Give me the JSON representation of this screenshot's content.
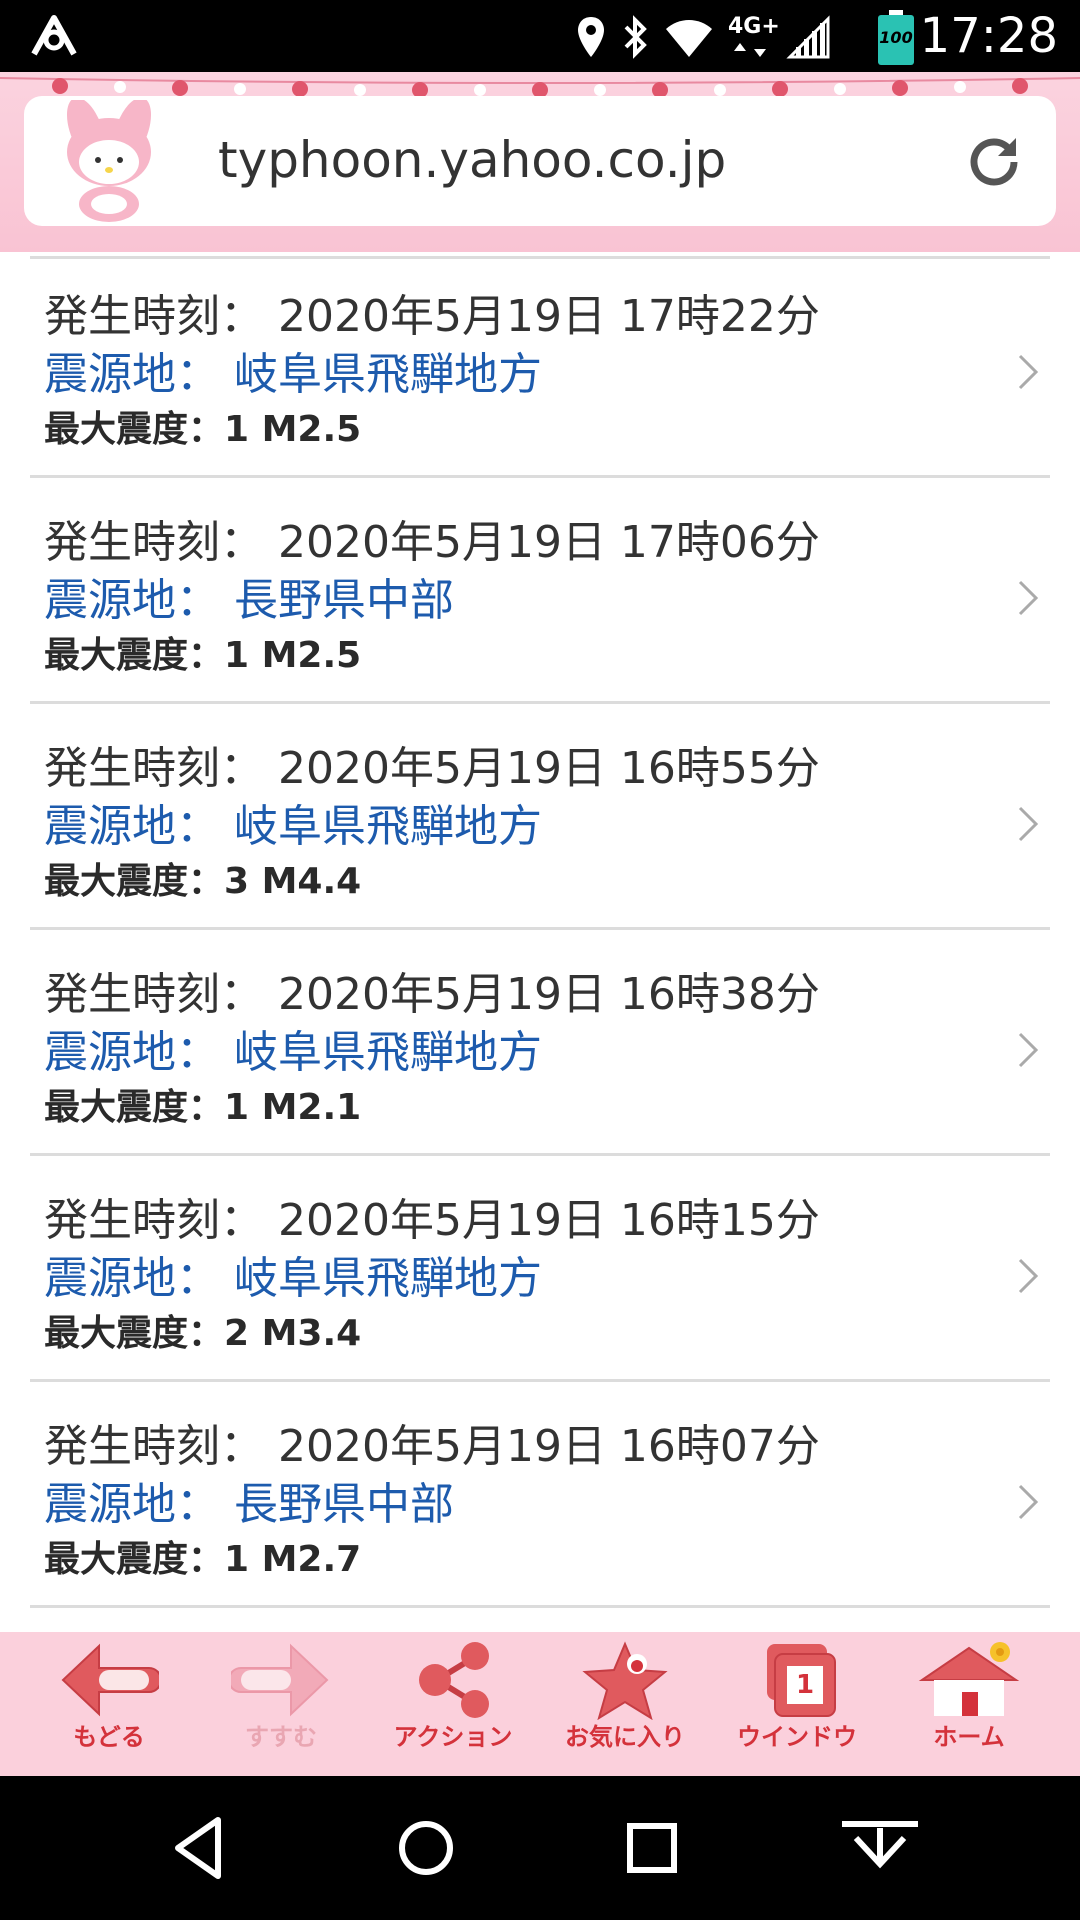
{
  "status_bar": {
    "network": "4G+",
    "battery": "100",
    "time": "17:28"
  },
  "browser": {
    "url": "typhoon.yahoo.co.jp"
  },
  "earthquakes": [
    {
      "time": "発生時刻： 2020年5月19日 17時22分",
      "epicenter": "震源地： 岐阜県飛騨地方",
      "intensity": "最大震度：1  M2.5"
    },
    {
      "time": "発生時刻： 2020年5月19日 17時06分",
      "epicenter": "震源地： 長野県中部",
      "intensity": "最大震度：1  M2.5"
    },
    {
      "time": "発生時刻： 2020年5月19日 16時55分",
      "epicenter": "震源地： 岐阜県飛騨地方",
      "intensity": "最大震度：3  M4.4"
    },
    {
      "time": "発生時刻： 2020年5月19日 16時38分",
      "epicenter": "震源地： 岐阜県飛騨地方",
      "intensity": "最大震度：1  M2.1"
    },
    {
      "time": "発生時刻： 2020年5月19日 16時15分",
      "epicenter": "震源地： 岐阜県飛騨地方",
      "intensity": "最大震度：2  M3.4"
    },
    {
      "time": "発生時刻： 2020年5月19日 16時07分",
      "epicenter": "震源地： 長野県中部",
      "intensity": "最大震度：1  M2.7"
    }
  ],
  "toolbar": {
    "back": "もどる",
    "forward": "すすむ",
    "action": "アクション",
    "favorites": "お気に入り",
    "window": "ウインドウ",
    "window_count": "1",
    "home": "ホーム"
  },
  "colors": {
    "accent": "#d4323b",
    "toolbar_bg": "#fbd0dc",
    "link_blue": "#1d5bad"
  },
  "icons": [
    "app-logo-icon",
    "location-icon",
    "bluetooth-icon",
    "wifi-icon",
    "signal-icon",
    "battery-icon",
    "mascot-icon",
    "reload-icon",
    "chevron-right-icon",
    "back-arrow-icon",
    "forward-arrow-icon",
    "share-icon",
    "star-icon",
    "window-icon",
    "home-icon",
    "nav-back-icon",
    "nav-home-icon",
    "nav-recents-icon",
    "nav-down-icon"
  ]
}
